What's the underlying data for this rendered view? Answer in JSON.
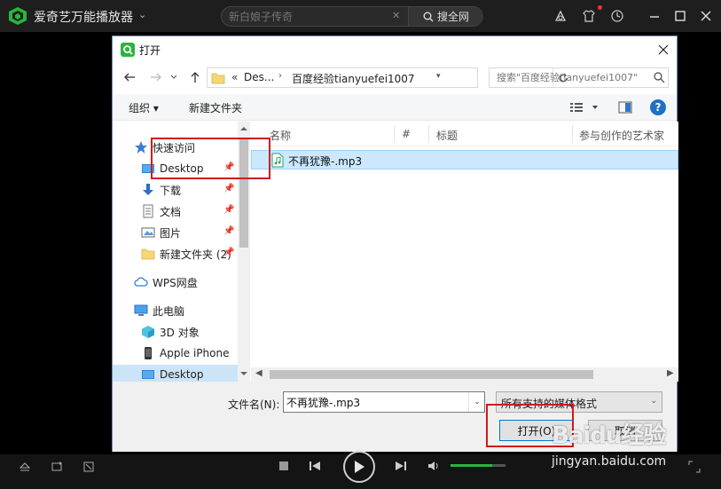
{
  "player": {
    "title": "爱奇艺万能播放器",
    "search_placeholder": "新白娘子传奇",
    "search_button": "搜全网",
    "accent": "#29b53b"
  },
  "dialog": {
    "title": "打开",
    "breadcrumbs": [
      "Des...",
      "百度经验tianyuefei1007"
    ],
    "breadcrumb_prefix": "«",
    "search_placeholder": "搜索\"百度经验tianyuefei1007\"",
    "toolbar": {
      "organize": "组织 ▾",
      "new_folder": "新建文件夹"
    },
    "nav_items": [
      {
        "label": "快速访问",
        "icon": "star-icon"
      },
      {
        "label": "Desktop",
        "icon": "desktop-icon"
      },
      {
        "label": "下载",
        "icon": "download-icon"
      },
      {
        "label": "文档",
        "icon": "document-icon"
      },
      {
        "label": "图片",
        "icon": "picture-icon"
      },
      {
        "label": "新建文件夹 (2)",
        "icon": "folder-icon"
      },
      {
        "label": "WPS网盘",
        "icon": "cloud-icon"
      },
      {
        "label": "此电脑",
        "icon": "computer-icon"
      },
      {
        "label": "3D 对象",
        "icon": "cube-icon"
      },
      {
        "label": "Apple iPhone",
        "icon": "phone-icon"
      },
      {
        "label": "Desktop",
        "icon": "desktop-icon"
      }
    ],
    "columns": [
      "名称",
      "#",
      "标题",
      "参与创作的艺术家"
    ],
    "files": [
      {
        "name": "不再犹豫-.mp3",
        "icon": "music-file-icon"
      }
    ],
    "filename_label": "文件名(N):",
    "filename_value": "不再犹豫-.mp3",
    "filetype": "所有支持的媒体格式",
    "open_button": "打开(O)",
    "cancel_button": "取消"
  },
  "player_controls": {
    "volume_level": 0.75
  },
  "watermark": {
    "logo": "Baidu经验",
    "site": "jingyan.baidu.com"
  }
}
